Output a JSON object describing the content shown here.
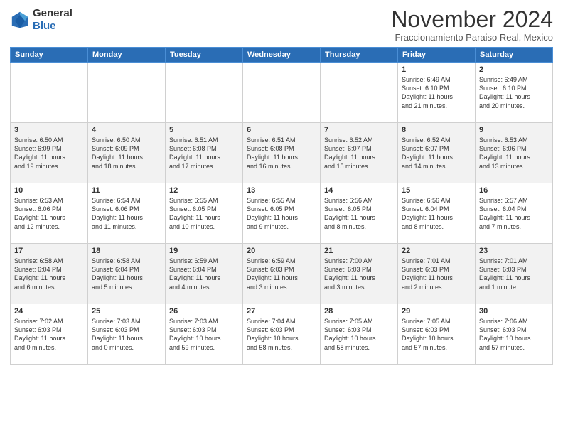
{
  "header": {
    "logo": {
      "general": "General",
      "blue": "Blue"
    },
    "month": "November 2024",
    "location": "Fraccionamiento Paraiso Real, Mexico"
  },
  "weekdays": [
    "Sunday",
    "Monday",
    "Tuesday",
    "Wednesday",
    "Thursday",
    "Friday",
    "Saturday"
  ],
  "weeks": [
    [
      {
        "day": "",
        "content": ""
      },
      {
        "day": "",
        "content": ""
      },
      {
        "day": "",
        "content": ""
      },
      {
        "day": "",
        "content": ""
      },
      {
        "day": "",
        "content": ""
      },
      {
        "day": "1",
        "content": "Sunrise: 6:49 AM\nSunset: 6:10 PM\nDaylight: 11 hours\nand 21 minutes."
      },
      {
        "day": "2",
        "content": "Sunrise: 6:49 AM\nSunset: 6:10 PM\nDaylight: 11 hours\nand 20 minutes."
      }
    ],
    [
      {
        "day": "3",
        "content": "Sunrise: 6:50 AM\nSunset: 6:09 PM\nDaylight: 11 hours\nand 19 minutes."
      },
      {
        "day": "4",
        "content": "Sunrise: 6:50 AM\nSunset: 6:09 PM\nDaylight: 11 hours\nand 18 minutes."
      },
      {
        "day": "5",
        "content": "Sunrise: 6:51 AM\nSunset: 6:08 PM\nDaylight: 11 hours\nand 17 minutes."
      },
      {
        "day": "6",
        "content": "Sunrise: 6:51 AM\nSunset: 6:08 PM\nDaylight: 11 hours\nand 16 minutes."
      },
      {
        "day": "7",
        "content": "Sunrise: 6:52 AM\nSunset: 6:07 PM\nDaylight: 11 hours\nand 15 minutes."
      },
      {
        "day": "8",
        "content": "Sunrise: 6:52 AM\nSunset: 6:07 PM\nDaylight: 11 hours\nand 14 minutes."
      },
      {
        "day": "9",
        "content": "Sunrise: 6:53 AM\nSunset: 6:06 PM\nDaylight: 11 hours\nand 13 minutes."
      }
    ],
    [
      {
        "day": "10",
        "content": "Sunrise: 6:53 AM\nSunset: 6:06 PM\nDaylight: 11 hours\nand 12 minutes."
      },
      {
        "day": "11",
        "content": "Sunrise: 6:54 AM\nSunset: 6:06 PM\nDaylight: 11 hours\nand 11 minutes."
      },
      {
        "day": "12",
        "content": "Sunrise: 6:55 AM\nSunset: 6:05 PM\nDaylight: 11 hours\nand 10 minutes."
      },
      {
        "day": "13",
        "content": "Sunrise: 6:55 AM\nSunset: 6:05 PM\nDaylight: 11 hours\nand 9 minutes."
      },
      {
        "day": "14",
        "content": "Sunrise: 6:56 AM\nSunset: 6:05 PM\nDaylight: 11 hours\nand 8 minutes."
      },
      {
        "day": "15",
        "content": "Sunrise: 6:56 AM\nSunset: 6:04 PM\nDaylight: 11 hours\nand 8 minutes."
      },
      {
        "day": "16",
        "content": "Sunrise: 6:57 AM\nSunset: 6:04 PM\nDaylight: 11 hours\nand 7 minutes."
      }
    ],
    [
      {
        "day": "17",
        "content": "Sunrise: 6:58 AM\nSunset: 6:04 PM\nDaylight: 11 hours\nand 6 minutes."
      },
      {
        "day": "18",
        "content": "Sunrise: 6:58 AM\nSunset: 6:04 PM\nDaylight: 11 hours\nand 5 minutes."
      },
      {
        "day": "19",
        "content": "Sunrise: 6:59 AM\nSunset: 6:04 PM\nDaylight: 11 hours\nand 4 minutes."
      },
      {
        "day": "20",
        "content": "Sunrise: 6:59 AM\nSunset: 6:03 PM\nDaylight: 11 hours\nand 3 minutes."
      },
      {
        "day": "21",
        "content": "Sunrise: 7:00 AM\nSunset: 6:03 PM\nDaylight: 11 hours\nand 3 minutes."
      },
      {
        "day": "22",
        "content": "Sunrise: 7:01 AM\nSunset: 6:03 PM\nDaylight: 11 hours\nand 2 minutes."
      },
      {
        "day": "23",
        "content": "Sunrise: 7:01 AM\nSunset: 6:03 PM\nDaylight: 11 hours\nand 1 minute."
      }
    ],
    [
      {
        "day": "24",
        "content": "Sunrise: 7:02 AM\nSunset: 6:03 PM\nDaylight: 11 hours\nand 0 minutes."
      },
      {
        "day": "25",
        "content": "Sunrise: 7:03 AM\nSunset: 6:03 PM\nDaylight: 11 hours\nand 0 minutes."
      },
      {
        "day": "26",
        "content": "Sunrise: 7:03 AM\nSunset: 6:03 PM\nDaylight: 10 hours\nand 59 minutes."
      },
      {
        "day": "27",
        "content": "Sunrise: 7:04 AM\nSunset: 6:03 PM\nDaylight: 10 hours\nand 58 minutes."
      },
      {
        "day": "28",
        "content": "Sunrise: 7:05 AM\nSunset: 6:03 PM\nDaylight: 10 hours\nand 58 minutes."
      },
      {
        "day": "29",
        "content": "Sunrise: 7:05 AM\nSunset: 6:03 PM\nDaylight: 10 hours\nand 57 minutes."
      },
      {
        "day": "30",
        "content": "Sunrise: 7:06 AM\nSunset: 6:03 PM\nDaylight: 10 hours\nand 57 minutes."
      }
    ]
  ]
}
